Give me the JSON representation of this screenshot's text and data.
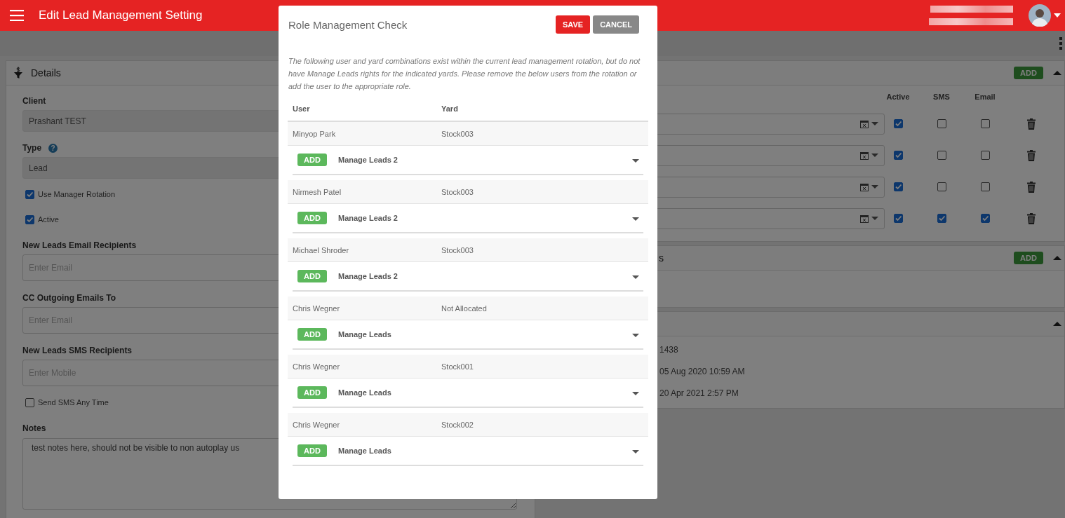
{
  "header": {
    "title": "Edit Lead Management Setting"
  },
  "details": {
    "title": "Details",
    "fields": [
      {
        "kind": "text",
        "label": "Client",
        "value": "Prashant TEST",
        "disabled": true
      },
      {
        "kind": "text",
        "label": "Type",
        "help": "?",
        "value": "Lead",
        "disabled": true
      },
      {
        "kind": "checkbox",
        "label": "Use Manager Rotation",
        "checked": true
      },
      {
        "kind": "checkbox",
        "label": "Active",
        "checked": true
      },
      {
        "kind": "text",
        "label": "New Leads Email Recipients",
        "placeholder": "Enter Email",
        "disabled": false
      },
      {
        "kind": "text",
        "label": "CC Outgoing Emails To",
        "placeholder": "Enter Email",
        "disabled": false
      },
      {
        "kind": "text",
        "label": "New Leads SMS Recipients",
        "placeholder": "Enter Mobile",
        "disabled": false
      },
      {
        "kind": "checkbox",
        "label": "Send SMS Any Time",
        "checked": false
      },
      {
        "kind": "textarea",
        "label": "Notes",
        "value": "test notes here, should not be visible to non autoplay us"
      }
    ]
  },
  "schedule_panel": {
    "button": "ADD",
    "columns": [
      "Active",
      "SMS",
      "Email"
    ],
    "rows": [
      {
        "active": true,
        "sms": false,
        "email": false
      },
      {
        "active": true,
        "sms": false,
        "email": false
      },
      {
        "active": true,
        "sms": false,
        "email": false
      },
      {
        "active": true,
        "sms": true,
        "email": true
      }
    ]
  },
  "recipients_panel": {
    "title": "s",
    "button": "ADD"
  },
  "info_panel": {
    "values": [
      "1438",
      "05 Aug 2020 10:59 AM",
      "20 Apr 2021 2:57 PM"
    ]
  },
  "dialog": {
    "title": "Role Management Check",
    "buttons": [
      {
        "label": "SAVE",
        "kind": "primary"
      },
      {
        "label": "CANCEL",
        "kind": "secondary"
      }
    ],
    "message": "The following user and yard combinations exist within the current lead management rotation, but do not have Manage Leads rights for the indicated yards. Please remove the below users from the rotation or add the user to the appropriate role.",
    "columns": [
      "User",
      "Yard"
    ],
    "rows": [
      {
        "user": "Minyop Park",
        "yard": "Stock003",
        "button": "ADD",
        "role": "Manage Leads 2"
      },
      {
        "user": "Nirmesh Patel",
        "yard": "Stock003",
        "button": "ADD",
        "role": "Manage Leads 2"
      },
      {
        "user": "Michael Shroder",
        "yard": "Stock003",
        "button": "ADD",
        "role": "Manage Leads 2"
      },
      {
        "user": "Chris Wegner",
        "yard": "Not Allocated",
        "button": "ADD",
        "role": "Manage Leads"
      },
      {
        "user": "Chris Wegner",
        "yard": "Stock001",
        "button": "ADD",
        "role": "Manage Leads"
      },
      {
        "user": "Chris Wegner",
        "yard": "Stock002",
        "button": "ADD",
        "role": "Manage Leads"
      }
    ]
  }
}
